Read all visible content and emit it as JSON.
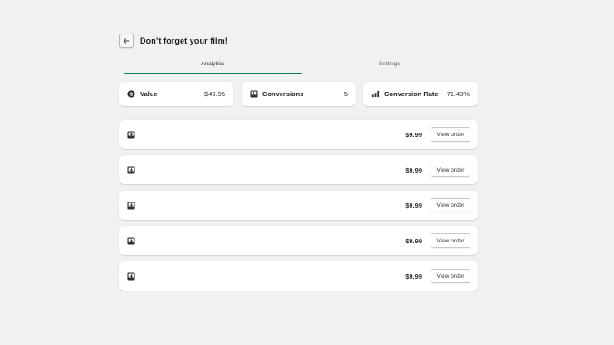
{
  "header": {
    "title": "Don’t forget your film!",
    "back_icon": "arrow-left-icon"
  },
  "tabs": [
    {
      "label": "Analytics",
      "active": true
    },
    {
      "label": "Settings",
      "active": false
    }
  ],
  "stats": {
    "value": {
      "label": "Value",
      "amount": "$49.95",
      "icon": "dollar-icon"
    },
    "conversions": {
      "label": "Conversions",
      "amount": "5",
      "icon": "download-icon"
    },
    "conversion_rate": {
      "label": "Conversion Rate",
      "amount": "71.43%",
      "icon": "bar-chart-icon"
    }
  },
  "orders": [
    {
      "price": "$9.99",
      "button": "View order",
      "icon": "download-icon"
    },
    {
      "price": "$9.99",
      "button": "View order",
      "icon": "download-icon"
    },
    {
      "price": "$9.99",
      "button": "View order",
      "icon": "download-icon"
    },
    {
      "price": "$9.99",
      "button": "View order",
      "icon": "download-icon"
    },
    {
      "price": "$9.99",
      "button": "View order",
      "icon": "download-icon"
    }
  ],
  "colors": {
    "accent": "#008060",
    "background": "#f1f1f1",
    "card": "#ffffff"
  }
}
